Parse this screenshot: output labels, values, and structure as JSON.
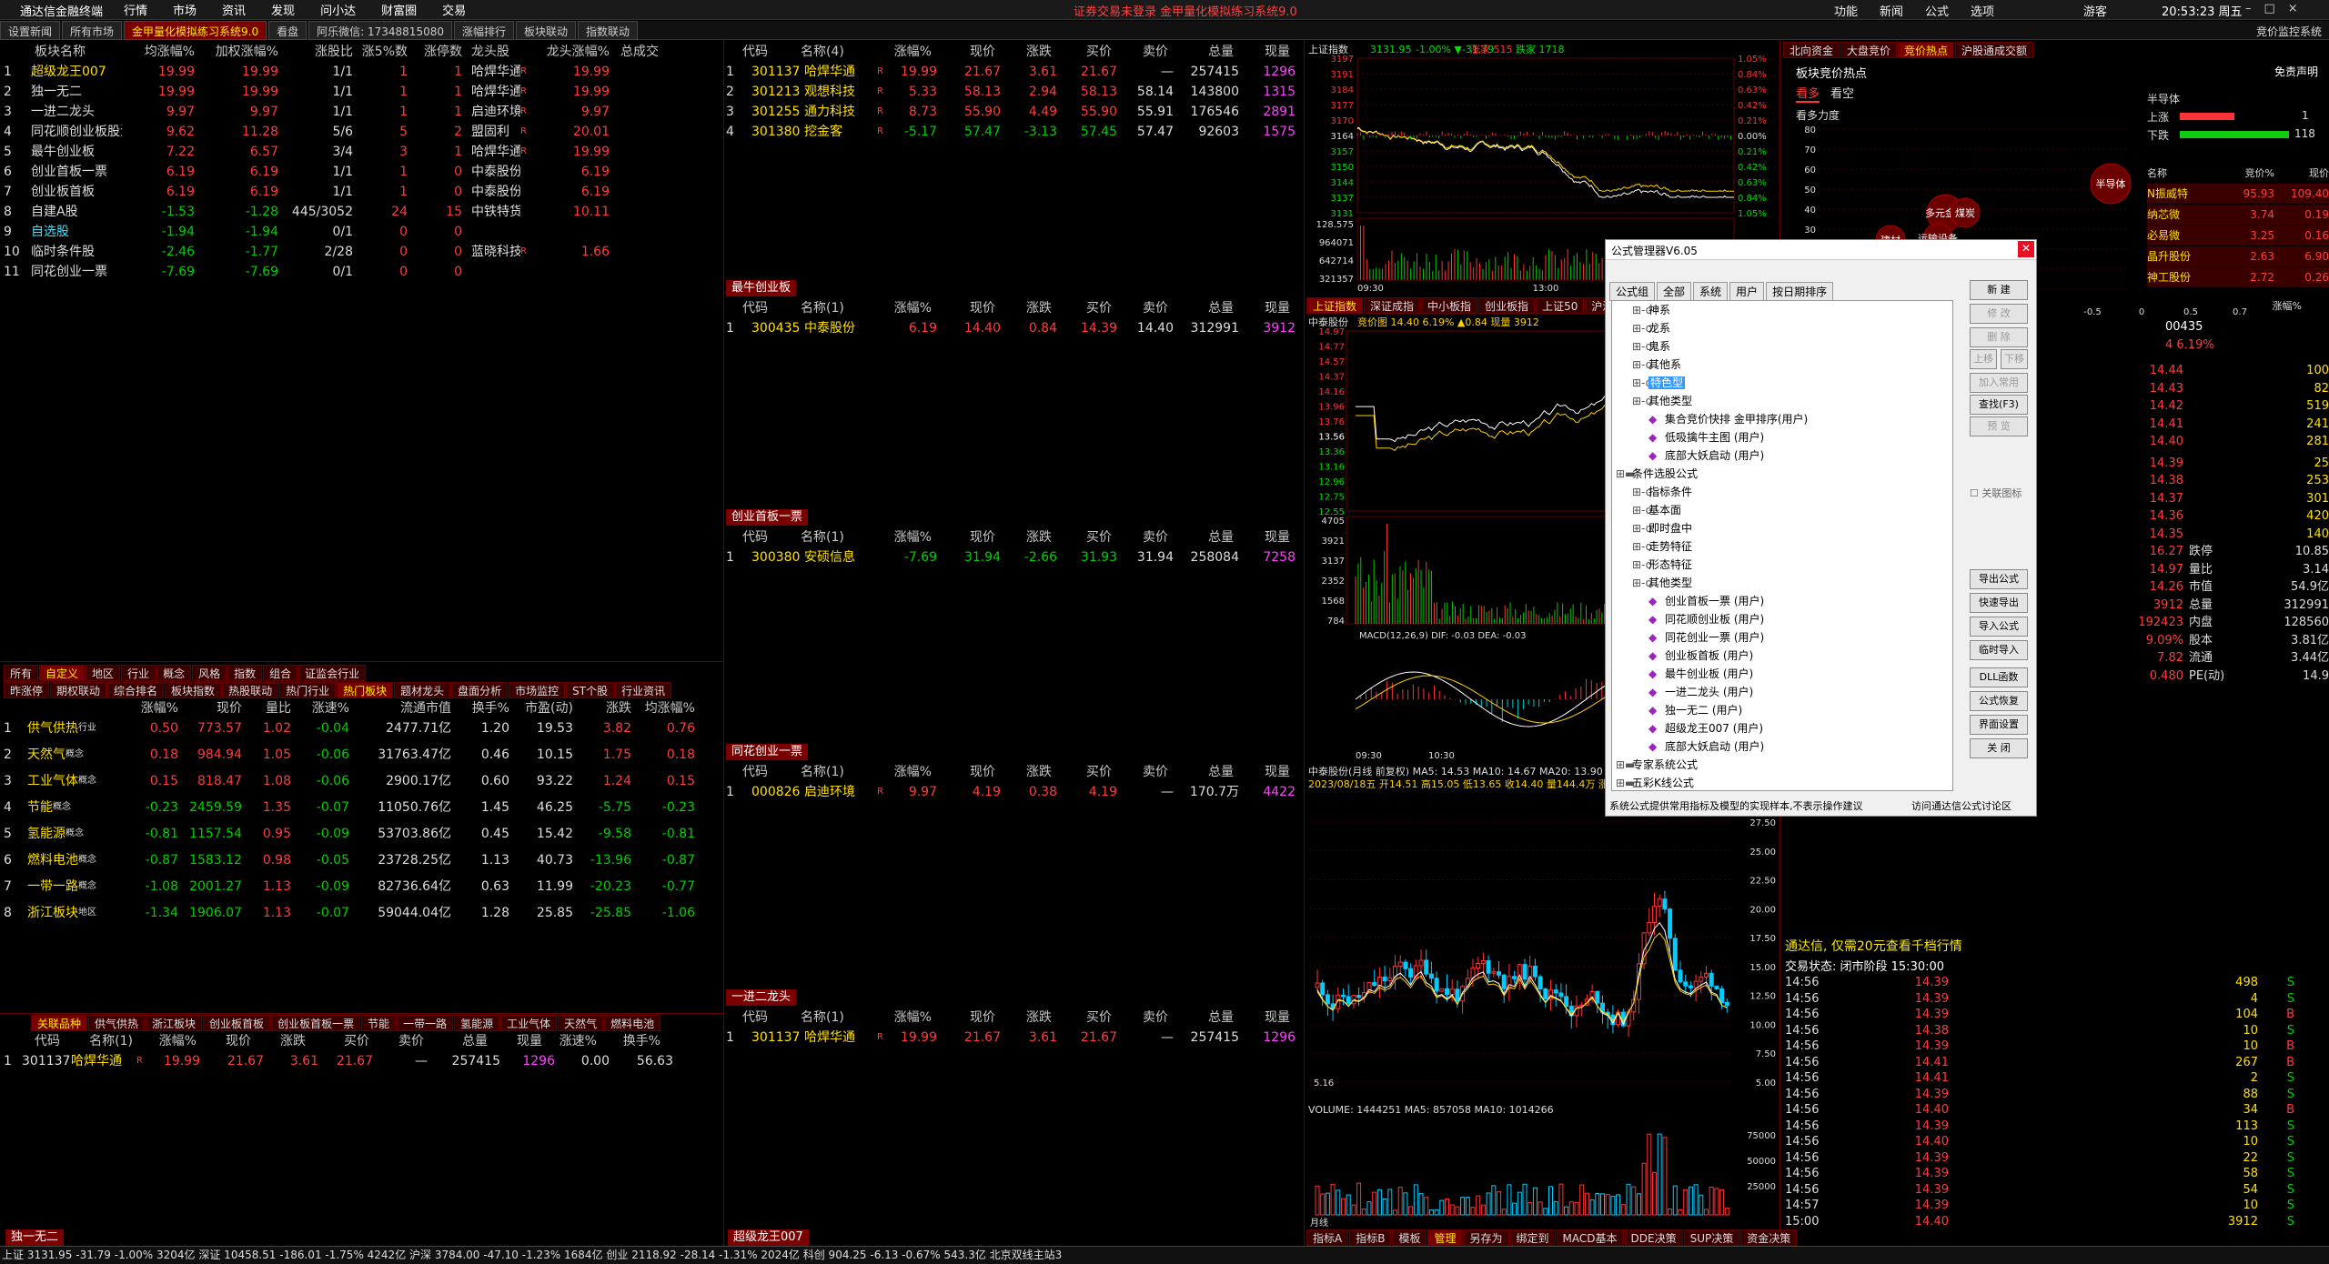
{
  "titlebar": {
    "app": "通达信金融终端",
    "menu": [
      "行情",
      "市场",
      "资讯",
      "发现",
      "问小达",
      "财富圈",
      "交易"
    ],
    "center": "证券交易未登录   金甲量化模拟练习系统9.0",
    "right": [
      "功能",
      "新闻",
      "公式",
      "选项"
    ],
    "user": "游客",
    "clock": "20:53:23 周五"
  },
  "top_tabs": [
    "设置新闻",
    "所有市场",
    "金甲量化模拟练习系统9.0",
    "看盘",
    "阿乐微信: 17348815080",
    "涨幅排行",
    "板块联动",
    "指数联动"
  ],
  "right_header": "竞价监控系统",
  "sector_table": {
    "headers": [
      "板块名称",
      "均涨幅%",
      "加权涨幅%",
      "涨股比",
      "涨5%数",
      "涨停数",
      "龙头股",
      "龙头涨幅%",
      "总成交"
    ],
    "rows": [
      [
        "1",
        "超级龙王007",
        "19.99",
        "19.99",
        "1/1",
        "1",
        "1",
        "哈焊华通",
        "R",
        "19.99"
      ],
      [
        "2",
        "独一无二",
        "19.99",
        "19.99",
        "1/1",
        "1",
        "1",
        "哈焊华通",
        "R",
        "19.99"
      ],
      [
        "3",
        "一进二龙头",
        "9.97",
        "9.97",
        "1/1",
        "1",
        "1",
        "启迪环境",
        "R",
        "9.97"
      ],
      [
        "4",
        "同花顺创业板股池",
        "9.62",
        "11.28",
        "5/6",
        "5",
        "2",
        "盟固利",
        "R",
        "20.01"
      ],
      [
        "5",
        "最牛创业板",
        "7.22",
        "6.57",
        "3/4",
        "3",
        "1",
        "哈焊华通",
        "R",
        "19.99"
      ],
      [
        "6",
        "创业首板一票",
        "6.19",
        "6.19",
        "1/1",
        "1",
        "0",
        "中泰股份",
        "",
        "6.19"
      ],
      [
        "7",
        "创业板首板",
        "6.19",
        "6.19",
        "1/1",
        "1",
        "0",
        "中泰股份",
        "",
        "6.19"
      ],
      [
        "8",
        "自建A股",
        "-1.53",
        "-1.28",
        "445/3052",
        "24",
        "15",
        "中铁特货",
        "",
        "10.11"
      ],
      [
        "9",
        "自选股",
        "-1.94",
        "-1.94",
        "0/1",
        "0",
        "0",
        "",
        "",
        ""
      ],
      [
        "10",
        "临时条件股",
        "-2.46",
        "-1.77",
        "2/28",
        "0",
        "0",
        "蓝晓科技",
        "R",
        "1.66"
      ],
      [
        "11",
        "同花创业一票",
        "-7.69",
        "-7.69",
        "0/1",
        "0",
        "0",
        "",
        "",
        ""
      ]
    ]
  },
  "mid_tabs1": [
    "所有",
    "自定义",
    "地区",
    "行业",
    "概念",
    "风格",
    "指数",
    "组合",
    "证监会行业"
  ],
  "mid_tabs2": [
    "昨涨停",
    "期权联动",
    "综合排名",
    "板块指数",
    "热股联动",
    "热门行业",
    "热门板块",
    "题材龙头",
    "盘面分析",
    "市场监控",
    "ST个股",
    "行业资讯"
  ],
  "hot_table": {
    "headers": [
      "",
      "涨幅%",
      "现价",
      "量比",
      "涨速%",
      "流通市值",
      "换手%",
      "市盈(动)",
      "涨跌",
      "均涨幅%"
    ],
    "rows": [
      [
        "1",
        "供气供热",
        "行业",
        "0.50",
        "773.57",
        "1.02",
        "-0.04",
        "2477.71亿",
        "1.20",
        "19.53",
        "3.82",
        "0.76"
      ],
      [
        "2",
        "天然气",
        "概念",
        "0.18",
        "984.94",
        "1.05",
        "-0.06",
        "31763.47亿",
        "0.46",
        "10.15",
        "1.75",
        "0.18"
      ],
      [
        "3",
        "工业气体",
        "概念",
        "0.15",
        "818.47",
        "1.08",
        "-0.06",
        "2900.17亿",
        "0.60",
        "93.22",
        "1.24",
        "0.15"
      ],
      [
        "4",
        "节能",
        "概念",
        "-0.23",
        "2459.59",
        "1.35",
        "-0.07",
        "11050.76亿",
        "1.45",
        "46.25",
        "-5.75",
        "-0.23"
      ],
      [
        "5",
        "氢能源",
        "概念",
        "-0.81",
        "1157.54",
        "0.95",
        "-0.09",
        "53703.86亿",
        "0.45",
        "15.42",
        "-9.58",
        "-0.81"
      ],
      [
        "6",
        "燃料电池",
        "概念",
        "-0.87",
        "1583.12",
        "0.98",
        "-0.05",
        "23728.25亿",
        "1.13",
        "40.73",
        "-13.96",
        "-0.87"
      ],
      [
        "7",
        "一带一路",
        "概念",
        "-1.08",
        "2001.27",
        "1.13",
        "-0.09",
        "82736.64亿",
        "0.63",
        "11.99",
        "-20.23",
        "-0.77"
      ],
      [
        "8",
        "浙江板块",
        "地区",
        "-1.34",
        "1906.07",
        "1.13",
        "-0.07",
        "59044.04亿",
        "1.28",
        "25.85",
        "-25.85",
        "-1.06"
      ]
    ]
  },
  "related_tabs": [
    "关联品种",
    "供气供热",
    "浙江板块",
    "创业板首板",
    "创业板首板一票",
    "节能",
    "一带一路",
    "氢能源",
    "工业气体",
    "天然气",
    "燃料电池"
  ],
  "related_table": {
    "headers": [
      "代码",
      "名称(1)",
      "涨幅%",
      "现价",
      "涨跌",
      "买价",
      "卖价",
      "总量",
      "现量",
      "涨速%",
      "换手%"
    ],
    "rows": [
      [
        "1",
        "301137",
        "哈焊华通",
        "R",
        "19.99",
        "21.67",
        "3.61",
        "21.67",
        "—",
        "257415",
        "1296",
        "0.00",
        "56.63"
      ]
    ]
  },
  "bottom_tag_left": "独一无二",
  "stock_headers": [
    "代码",
    "名称",
    "涨幅%",
    "现价",
    "涨跌",
    "买价",
    "卖价",
    "总量",
    "现量"
  ],
  "block1": {
    "rows": [
      [
        "1",
        "301137",
        "哈焊华通",
        "R",
        "19.99",
        "21.67",
        "3.61",
        "21.67",
        "—",
        "257415",
        "1296"
      ],
      [
        "2",
        "301213",
        "观想科技",
        "R",
        "5.33",
        "58.13",
        "2.94",
        "58.13",
        "58.14",
        "143800",
        "1315"
      ],
      [
        "3",
        "301255",
        "通力科技",
        "R",
        "8.73",
        "55.90",
        "4.49",
        "55.90",
        "55.91",
        "176546",
        "2891"
      ],
      [
        "4",
        "301380",
        "挖金客",
        "R",
        "-5.17",
        "57.47",
        "-3.13",
        "57.45",
        "57.47",
        "92603",
        "1575"
      ]
    ],
    "name_hdr": "名称(4)"
  },
  "block2": {
    "tag": "最牛创业板",
    "rows": [
      [
        "1",
        "300435",
        "中泰股份",
        "",
        "6.19",
        "14.40",
        "0.84",
        "14.39",
        "14.40",
        "312991",
        "3912"
      ]
    ],
    "name_hdr": "名称(1)"
  },
  "block3": {
    "tag": "创业首板一票",
    "rows": [
      [
        "1",
        "300380",
        "安硕信息",
        "",
        "-7.69",
        "31.94",
        "-2.66",
        "31.93",
        "31.94",
        "258084",
        "7258"
      ]
    ],
    "name_hdr": "名称(1)"
  },
  "block4": {
    "tag": "同花创业一票",
    "rows": [
      [
        "1",
        "000826",
        "启迪环境",
        "R",
        "9.97",
        "4.19",
        "0.38",
        "4.19",
        "—",
        "170.7万",
        "4422"
      ]
    ],
    "name_hdr": "名称(1)"
  },
  "block5": {
    "tag": "一进二龙头",
    "rows": [
      [
        "1",
        "301137",
        "哈焊华通",
        "R",
        "19.99",
        "21.67",
        "3.61",
        "21.67",
        "—",
        "257415",
        "1296"
      ]
    ],
    "name_hdr": "名称(1)"
  },
  "block6": {
    "tag": "超级龙王007"
  },
  "index_chart": {
    "title": "上证指数",
    "value": "3131.95",
    "chg": "-1.00%",
    "dn": "-31.79",
    "up_cnt": "涨家 515",
    "dn_cnt": "跌家 1718",
    "yticks": [
      "3197",
      "3191",
      "3184",
      "3177",
      "3170",
      "3164",
      "3157",
      "3150",
      "3144",
      "3137",
      "3131"
    ],
    "ryticks": [
      "1.05%",
      "0.84%",
      "0.63%",
      "0.42%",
      "0.21%",
      "0.00%",
      "0.21%",
      "0.42%",
      "0.63%",
      "0.84%",
      "1.05%"
    ],
    "vols": [
      "128.575",
      "964071",
      "642714",
      "321357"
    ],
    "xlabels": [
      "09:30",
      "13:00"
    ]
  },
  "mini_tabs": [
    "上证指数",
    "深证成指",
    "中小板指",
    "创业板指",
    "上证50",
    "沪深300"
  ],
  "min_chart": {
    "title": "中泰股份",
    "info": "竞价图 14.40 6.19% ▲0.84 现量 3912",
    "yticks": [
      "14.97",
      "14.77",
      "14.57",
      "14.37",
      "14.16",
      "13.96",
      "13.76",
      "13.56",
      "13.36",
      "13.16",
      "12.96",
      "12.75",
      "12.55"
    ],
    "vol": [
      "4705",
      "3921",
      "3137",
      "2352",
      "1568",
      "784"
    ],
    "macd": "MACD(12,26,9)  DIF: -0.03  DEA: -0.03",
    "xlabels": [
      "09:30",
      "10:30"
    ]
  },
  "kline": {
    "title": "中泰股份(月线 前复权)",
    "ma": "MA5: 14.53  MA10: 14.67  MA20: 13.90",
    "info": "2023/08/18五 开14.51 高15.05 低13.65 收14.40 量144.4万 涨0.84",
    "yticks": [
      "27.50",
      "25.00",
      "22.50",
      "20.00",
      "17.50",
      "15.00",
      "12.50",
      "10.00",
      "7.50",
      "5.00"
    ],
    "low": "5.16",
    "vol": "VOLUME: 1444251  MA5: 857058  MA10: 1014266",
    "vticks": [
      "75000",
      "50000",
      "25000"
    ],
    "bottom_tabs": [
      "指标A",
      "指标B",
      "模板",
      "管理",
      "另存为",
      "绑定到",
      "MACD基本",
      "DDE决策",
      "SUP决策",
      "资金决策"
    ],
    "period": "月线"
  },
  "right_panel": {
    "tabs": [
      "北向资金",
      "大盘竞价",
      "竞价热点",
      "沪股通成交额"
    ],
    "title": "板块竞价热点",
    "disclaimer": "免责声明",
    "sub": [
      "看多",
      "看空"
    ],
    "strength": "看多力度",
    "yticks": [
      "80",
      "70",
      "60",
      "50",
      "40",
      "30",
      "20",
      "10",
      "0"
    ],
    "bubbles": [
      "多元金融",
      "建材",
      "运输设备",
      "煤炭",
      "半导体"
    ],
    "semi": "半导体",
    "rise": "上涨",
    "rise_n": "1",
    "fall": "下跌",
    "fall_n": "118",
    "list_hdr": [
      "名称",
      "竞价%",
      "现价"
    ],
    "list": [
      [
        "N振威特",
        "95.93",
        "109.40"
      ],
      [
        "纳芯微",
        "3.74",
        "0.19"
      ],
      [
        "必易微",
        "3.25",
        "0.16"
      ],
      [
        "晶升股份",
        "2.63",
        "6.90"
      ],
      [
        "神工股份",
        "2.72",
        "0.26"
      ]
    ],
    "axis": [
      "-0.5",
      "0",
      "0.5",
      "0.7"
    ],
    "axis_lbl": "涨幅%"
  },
  "quote": {
    "code": "00435",
    "pct": "4  6.19%",
    "asks": [
      [
        "14.44",
        "100"
      ],
      [
        "14.43",
        "82"
      ],
      [
        "14.42",
        "519"
      ],
      [
        "14.41",
        "241"
      ],
      [
        "14.40",
        "281"
      ]
    ],
    "bids": [
      [
        "14.39",
        "25"
      ],
      [
        "14.38",
        "253"
      ],
      [
        "14.37",
        "301"
      ],
      [
        "14.36",
        "420"
      ],
      [
        "14.35",
        "140"
      ]
    ],
    "stats": [
      [
        "16.27",
        "跌停",
        "10.85"
      ],
      [
        "14.97",
        "量比",
        "3.14"
      ],
      [
        "14.26",
        "市值",
        "54.9亿"
      ],
      [
        "3912",
        "总量",
        "312991"
      ],
      [
        "192423",
        "内盘",
        "128560"
      ]
    ],
    "stats2": [
      [
        "9.09%",
        "股本",
        "3.81亿"
      ],
      [
        "7.82",
        "流通",
        "3.44亿"
      ],
      [
        "0.480",
        "PE(动)",
        "14.9"
      ]
    ]
  },
  "ticker": {
    "ad": "通达信, 仅需20元查看千档行情",
    "status": "交易状态: 闭市阶段 15:30:00",
    "rows": [
      [
        "14:56",
        "14.39",
        "498",
        "S"
      ],
      [
        "14:56",
        "14.39",
        "4",
        "S"
      ],
      [
        "14:56",
        "14.39",
        "104",
        "B"
      ],
      [
        "14:56",
        "14.38",
        "10",
        "S"
      ],
      [
        "14:56",
        "14.39",
        "10",
        "B"
      ],
      [
        "14:56",
        "14.41",
        "267",
        "B"
      ],
      [
        "14:56",
        "14.41",
        "2",
        "S"
      ],
      [
        "14:56",
        "14.39",
        "88",
        "S"
      ],
      [
        "14:56",
        "14.40",
        "34",
        "B"
      ],
      [
        "14:56",
        "14.39",
        "113",
        "S"
      ],
      [
        "14:56",
        "14.40",
        "10",
        "S"
      ],
      [
        "14:56",
        "14.39",
        "22",
        "S"
      ],
      [
        "14:56",
        "14.39",
        "58",
        "S"
      ],
      [
        "14:56",
        "14.39",
        "54",
        "S"
      ],
      [
        "14:57",
        "14.39",
        "10",
        "S"
      ],
      [
        "15:00",
        "14.40",
        "3912",
        "S"
      ]
    ]
  },
  "dialog": {
    "title": "公式管理器V6.05",
    "tabs": [
      "公式组",
      "全部",
      "系统",
      "用户",
      "按日期排序"
    ],
    "tree": [
      [
        "1",
        "神系"
      ],
      [
        "1",
        "龙系"
      ],
      [
        "1",
        "鬼系"
      ],
      [
        "1",
        "其他系"
      ],
      [
        "1",
        "特色型"
      ],
      [
        "1",
        "其他类型"
      ],
      [
        "2",
        "集合竞价快排 金甲排序(用户)"
      ],
      [
        "2",
        "低吸擒牛主图 (用户)"
      ],
      [
        "2",
        "底部大妖启动 (用户)"
      ],
      [
        "0",
        "条件选股公式"
      ],
      [
        "1",
        "指标条件"
      ],
      [
        "1",
        "基本面"
      ],
      [
        "1",
        "即时盘中"
      ],
      [
        "1",
        "走势特征"
      ],
      [
        "1",
        "形态特征"
      ],
      [
        "1",
        "其他类型"
      ],
      [
        "2",
        "创业首板一票 (用户)"
      ],
      [
        "2",
        "同花顺创业板 (用户)"
      ],
      [
        "2",
        "同花创业一票 (用户)"
      ],
      [
        "2",
        "创业板首板 (用户)"
      ],
      [
        "2",
        "最牛创业板 (用户)"
      ],
      [
        "2",
        "一进二龙头 (用户)"
      ],
      [
        "2",
        "独一无二 (用户)"
      ],
      [
        "2",
        "超级龙王007 (用户)"
      ],
      [
        "2",
        "底部大妖启动 (用户)"
      ],
      [
        "0",
        "专家系统公式"
      ],
      [
        "0",
        "五彩K线公式"
      ]
    ],
    "buttons": [
      "新 建",
      "修 改",
      "删 除",
      "上移",
      "下移",
      "加入常用",
      "查找(F3)",
      "预 览",
      "导出公式",
      "快速导出",
      "导入公式",
      "临时导入",
      "DLL函数",
      "公式恢复",
      "界面设置",
      "关 闭"
    ],
    "checkbox": "关联图标",
    "footer_l": "系统公式提供常用指标及模型的实现样本,不表示操作建议",
    "footer_r": "访问通达信公式讨论区"
  },
  "statusbar": "上证 3131.95  -31.79  -1.00%  3204亿   深证 10458.51  -186.01  -1.75%  4242亿   沪深 3784.00  -47.10  -1.23%  1684亿   创业 2118.92  -28.14  -1.31%  2024亿   科创 904.25  -6.13  -0.67%  543.3亿                    北京双线主站3"
}
